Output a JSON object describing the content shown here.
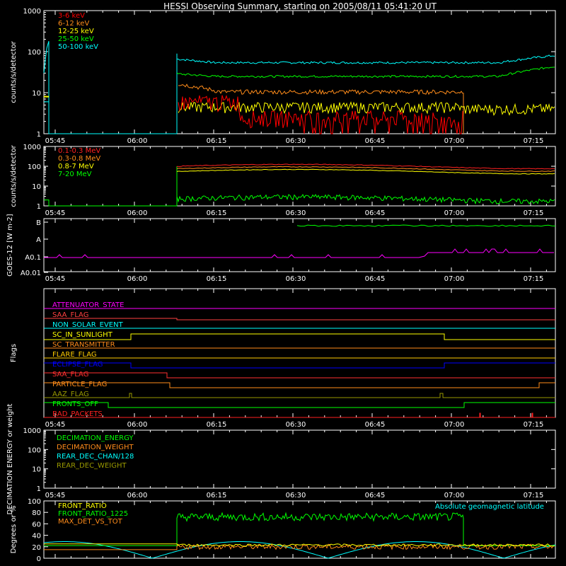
{
  "title": "HESSI Observing Summary, starting on 2005/08/11 05:41:20 UT",
  "time_ticks": [
    "05:45",
    "06:00",
    "06:15",
    "06:30",
    "06:45",
    "07:00",
    "07:15"
  ],
  "chart_data": [
    {
      "type": "line",
      "ylabel": "counts/s/detector",
      "yscale": "log",
      "ylim": [
        1,
        1000
      ],
      "ytick_labels": [
        "1",
        "10",
        "100",
        "1000"
      ],
      "legend_placement": "top-left",
      "series": [
        {
          "name": "3-6 keV",
          "color": "#ff0000"
        },
        {
          "name": "6-12 keV",
          "color": "#ff8c1a"
        },
        {
          "name": "12-25 keV",
          "color": "#ffff00"
        },
        {
          "name": "25-50 keV",
          "color": "#00ff00"
        },
        {
          "name": "50-100 keV",
          "color": "#00ffff"
        }
      ]
    },
    {
      "type": "line",
      "ylabel": "counts/s/detector",
      "yscale": "log",
      "ylim": [
        1,
        1000
      ],
      "ytick_labels": [
        "1",
        "10",
        "100",
        "1000"
      ],
      "legend_placement": "top-left",
      "series": [
        {
          "name": "0.1-0.3 MeV",
          "color": "#ff2020"
        },
        {
          "name": "0.3-0.8 MeV",
          "color": "#ff8c1a"
        },
        {
          "name": "0.8-7 MeV",
          "color": "#ffff00"
        },
        {
          "name": "7-20 MeV",
          "color": "#00ff00"
        }
      ]
    },
    {
      "type": "line",
      "ylabel": "GOES-12 [W m-2]",
      "ytick_labels": [
        "B",
        "A",
        "A0.1",
        "A0.01"
      ]
    },
    {
      "type": "line",
      "ylabel": "Flags",
      "flags": [
        {
          "name": "ATTENUATOR_STATE",
          "color": "#ff00ff"
        },
        {
          "name": "SAA_FLAG",
          "color": "#ff4040"
        },
        {
          "name": "NON_SOLAR_EVENT",
          "color": "#00ffff"
        },
        {
          "name": "SC_IN_SUNLIGHT",
          "color": "#ffff00"
        },
        {
          "name": "SC_TRANSMITTER",
          "color": "#ff8c1a"
        },
        {
          "name": "FLARE_FLAG",
          "color": "#ffcc00"
        },
        {
          "name": "ECLIPSE_FLAG",
          "color": "#0000ff"
        },
        {
          "name": "SAA_FLAG",
          "color": "#ff3030"
        },
        {
          "name": "PARTICLE_FLAG",
          "color": "#ff8c1a"
        },
        {
          "name": "AAZ_FLAG",
          "color": "#999900"
        },
        {
          "name": "FRONTS_OFF",
          "color": "#00ff00"
        },
        {
          "name": "BAD_PACKETS",
          "color": "#ff2020"
        }
      ]
    },
    {
      "type": "line",
      "ylabel": "DECIMATION ENERGY or weight",
      "ytick_labels": [
        "1",
        "10",
        "100",
        "1000"
      ],
      "series": [
        {
          "name": "DECIMATION_ENERGY",
          "color": "#00ff00"
        },
        {
          "name": "DECIMATION_WEIGHT",
          "color": "#ff8c1a"
        },
        {
          "name": "REAR_DEC_CHAN/128",
          "color": "#00ffff"
        },
        {
          "name": "REAR_DEC_WEIGHT",
          "color": "#999900"
        }
      ]
    },
    {
      "type": "line",
      "ylabel": "Degrees or %",
      "ylim": [
        0,
        100
      ],
      "ytick_labels": [
        "0",
        "20",
        "40",
        "60",
        "80",
        "100"
      ],
      "series": [
        {
          "name": "FRONT_RATIO",
          "color": "#ffff00"
        },
        {
          "name": "FRONT_RATIO_1225",
          "color": "#00ff00"
        },
        {
          "name": "MAX_DET_VS_TOT",
          "color": "#ff8c1a"
        },
        {
          "name": "Absolute geomagnetic latitude",
          "color": "#00ffff"
        }
      ]
    }
  ]
}
